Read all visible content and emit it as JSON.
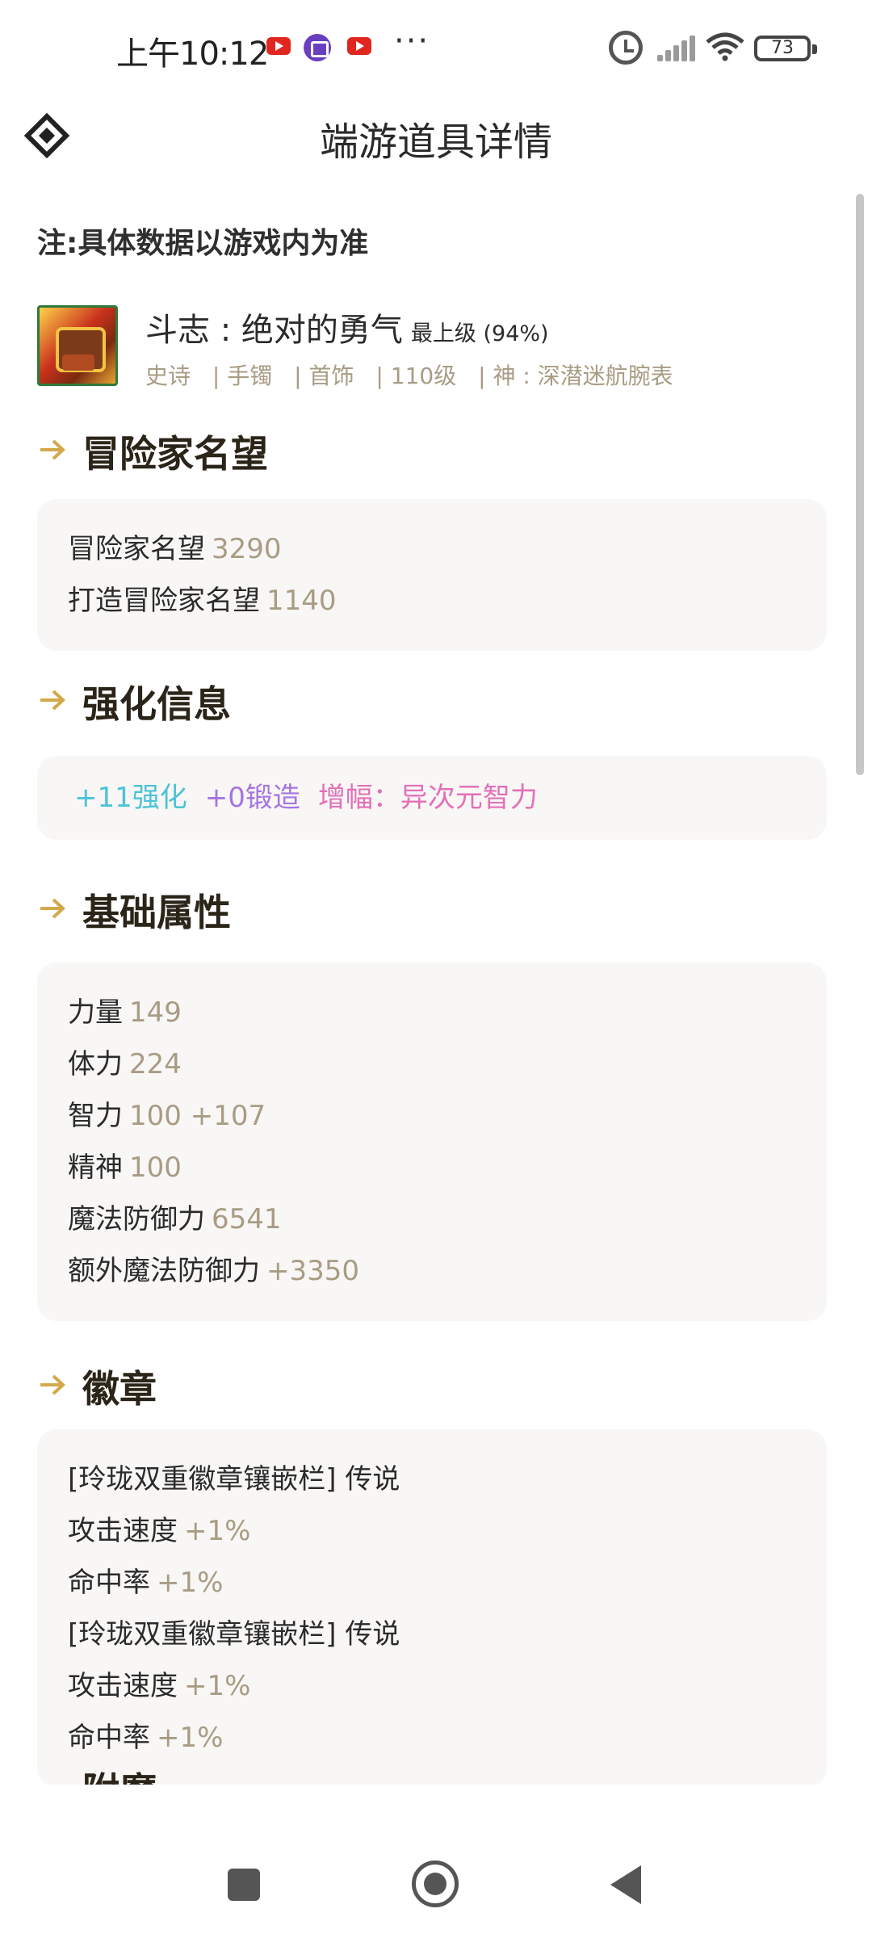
{
  "status_bar": {
    "time": "上午10:12",
    "more": "···",
    "battery": "73"
  },
  "header": {
    "title": "端游道具详情"
  },
  "note": "注:具体数据以游戏内为准",
  "item": {
    "name": "斗志 : 绝对的勇气",
    "grade": "最上级 (94%)",
    "tags": [
      "史诗",
      "| 手镯",
      "| 首饰",
      "| 110级",
      "| 神 : 深潜迷航腕表"
    ]
  },
  "sections": {
    "reputation": {
      "title": "冒险家名望",
      "rows": [
        {
          "label": "冒险家名望",
          "value": "3290"
        },
        {
          "label": "打造冒险家名望",
          "value": "1140"
        }
      ]
    },
    "enhance": {
      "title": "强化信息",
      "reinforce": "+11强化",
      "forge": "+0锻造",
      "amplify": "增幅：异次元智力"
    },
    "base": {
      "title": "基础属性",
      "rows": [
        {
          "label": "力量",
          "value": "149"
        },
        {
          "label": "体力",
          "value": "224"
        },
        {
          "label": "智力",
          "value": "100 +107"
        },
        {
          "label": "精神",
          "value": "100"
        },
        {
          "label": "魔法防御力",
          "value": "6541"
        },
        {
          "label": "额外魔法防御力",
          "value": "+3350"
        }
      ]
    },
    "emblem": {
      "title": "徽章",
      "rows": [
        {
          "label": "[玲珑双重徽章镶嵌栏] 传说",
          "value": ""
        },
        {
          "label": "攻击速度",
          "value": "+1%"
        },
        {
          "label": "命中率",
          "value": "+1%"
        },
        {
          "label": "[玲珑双重徽章镶嵌栏] 传说",
          "value": ""
        },
        {
          "label": "攻击速度",
          "value": "+1%"
        },
        {
          "label": "命中率",
          "value": "+1%"
        }
      ]
    },
    "next": {
      "title": "附魔"
    }
  },
  "colors": {
    "accent_arrow": "#d4a84a",
    "value_text": "#a89c84",
    "reinforce": "#4cc3d6",
    "forge": "#a675e0",
    "amplify": "#e370b8",
    "card_bg": "#f8f7f5"
  },
  "icons": {
    "back": "diamond-back-icon",
    "section": "arrow-right-icon",
    "nav_recents": "square-icon",
    "nav_home": "circle-home-icon",
    "nav_back": "triangle-back-icon"
  }
}
